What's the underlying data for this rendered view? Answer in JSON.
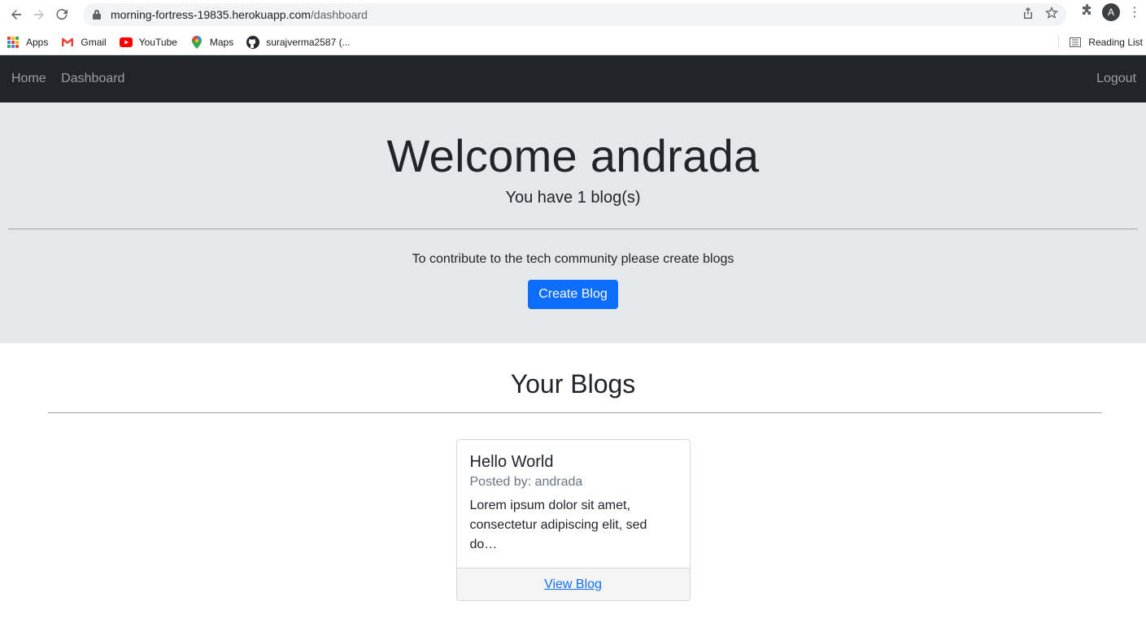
{
  "browser": {
    "url_host": "morning-fortress-19835.herokuapp.com",
    "url_path": "/dashboard",
    "profile_initial": "A",
    "bookmarks": [
      {
        "label": "Apps",
        "icon": "apps-grid-icon"
      },
      {
        "label": "Gmail",
        "icon": "gmail-icon"
      },
      {
        "label": "YouTube",
        "icon": "youtube-icon"
      },
      {
        "label": "Maps",
        "icon": "maps-icon"
      },
      {
        "label": "surajverma2587 (...",
        "icon": "github-icon"
      }
    ],
    "reading_list": "Reading List"
  },
  "navbar": {
    "home": "Home",
    "dashboard": "Dashboard",
    "logout": "Logout"
  },
  "hero": {
    "title": "Welcome andrada",
    "subtitle": "You have 1 blog(s)",
    "contribute_text": "To contribute to the tech community please create blogs",
    "create_button": "Create Blog"
  },
  "blogs_section": {
    "title": "Your Blogs",
    "blogs": [
      {
        "title": "Hello World",
        "posted_by": "Posted by: andrada",
        "excerpt": "Lorem ipsum dolor sit amet, consectetur adipiscing elit, sed do…",
        "link": "View Blog"
      }
    ]
  },
  "colors": {
    "navbar_bg": "#212529",
    "hero_bg": "#e5e8eb",
    "primary": "#0d6efd"
  }
}
